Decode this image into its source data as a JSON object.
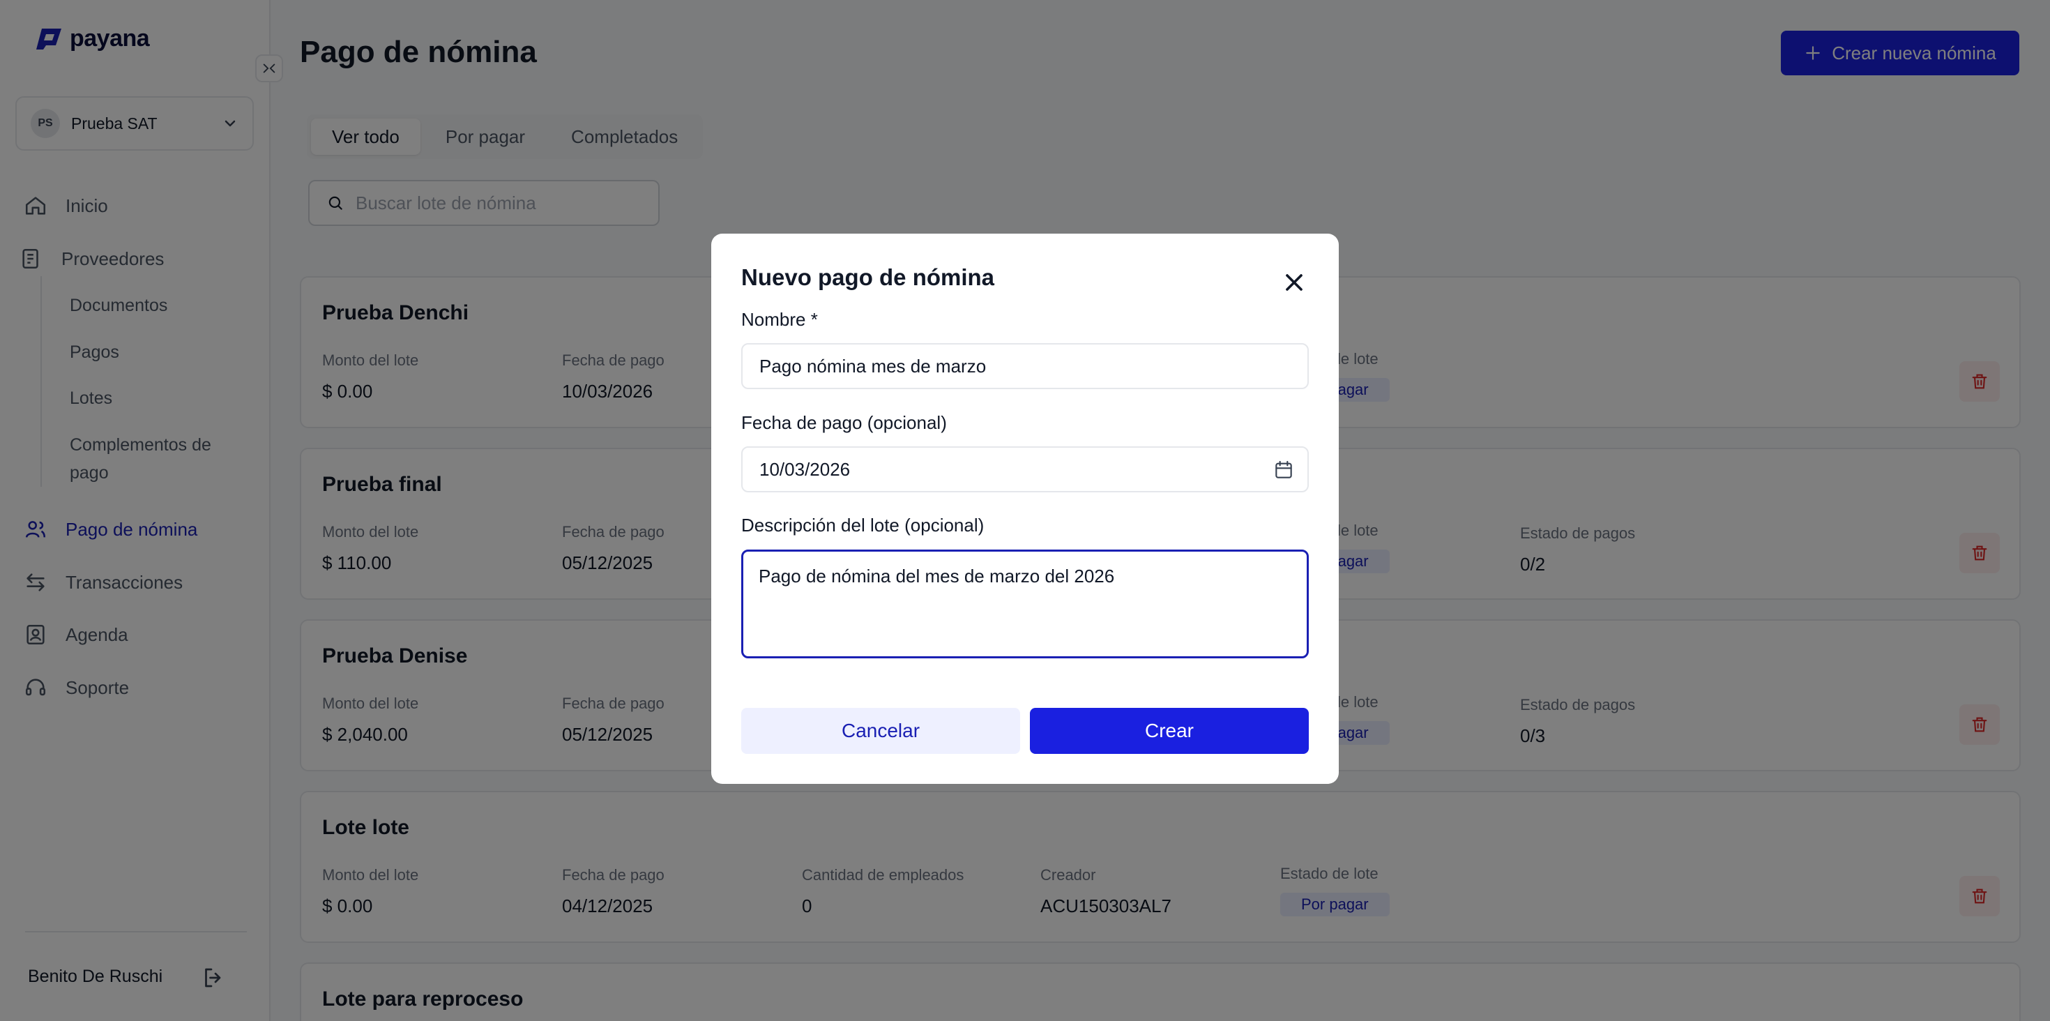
{
  "app": {
    "logo_text": "payana"
  },
  "sidebar": {
    "company": {
      "initials": "PS",
      "name": "Prueba SAT"
    },
    "items": [
      {
        "label": "Inicio",
        "icon": "home-icon"
      },
      {
        "label": "Proveedores",
        "icon": "invoice-icon"
      },
      {
        "label": "Pago de nómina",
        "icon": "users-icon",
        "active": true
      },
      {
        "label": "Transacciones",
        "icon": "arrows-icon"
      },
      {
        "label": "Agenda",
        "icon": "contact-book-icon"
      },
      {
        "label": "Soporte",
        "icon": "headset-icon"
      }
    ],
    "subitems": [
      "Documentos",
      "Pagos",
      "Lotes",
      "Complementos de pago"
    ],
    "user": "Benito De Ruschi"
  },
  "main": {
    "title": "Pago de nómina",
    "create_button": "Crear nueva nómina",
    "tabs": [
      {
        "label": "Ver todo",
        "active": true
      },
      {
        "label": "Por pagar"
      },
      {
        "label": "Completados"
      }
    ],
    "search_placeholder": "Buscar lote de nómina",
    "cards": [
      {
        "title": "Prueba Denchi",
        "amount_label": "Monto del lote",
        "amount": "$ 0.00",
        "date_label": "Fecha de pago",
        "date": "10/03/2026",
        "status_label": "Estado de lote",
        "status": "Por pagar"
      },
      {
        "title": "Prueba final",
        "amount_label": "Monto del lote",
        "amount": "$ 110.00",
        "date_label": "Fecha de pago",
        "date": "05/12/2025",
        "status_label": "Estado de lote",
        "status": "Por pagar",
        "payments_label": "Estado de pagos",
        "payments": "0/2"
      },
      {
        "title": "Prueba Denise",
        "amount_label": "Monto del lote",
        "amount": "$ 2,040.00",
        "date_label": "Fecha de pago",
        "date": "05/12/2025",
        "status_label": "Estado de lote",
        "status": "Por pagar",
        "payments_label": "Estado de pagos",
        "payments": "0/3"
      },
      {
        "title": "Lote lote",
        "amount_label": "Monto del lote",
        "amount": "$ 0.00",
        "date_label": "Fecha de pago",
        "date": "04/12/2025",
        "employees_label": "Cantidad de empleados",
        "employees": "0",
        "creator_label": "Creador",
        "creator": "ACU150303AL7",
        "status_label": "Estado de lote",
        "status": "Por pagar"
      },
      {
        "title": "Lote para reproceso"
      }
    ]
  },
  "modal": {
    "title": "Nuevo pago de nómina",
    "name_label": "Nombre *",
    "name_value": "Pago nómina mes de marzo",
    "date_label": "Fecha de pago (opcional)",
    "date_value": "10/03/2026",
    "description_label": "Descripción del lote (opcional)",
    "description_value": "Pago de nómina del mes de marzo del 2026",
    "cancel": "Cancelar",
    "create": "Crear"
  },
  "colors": {
    "accent": "#1a20e0",
    "accent_text": "#1a20b3"
  }
}
